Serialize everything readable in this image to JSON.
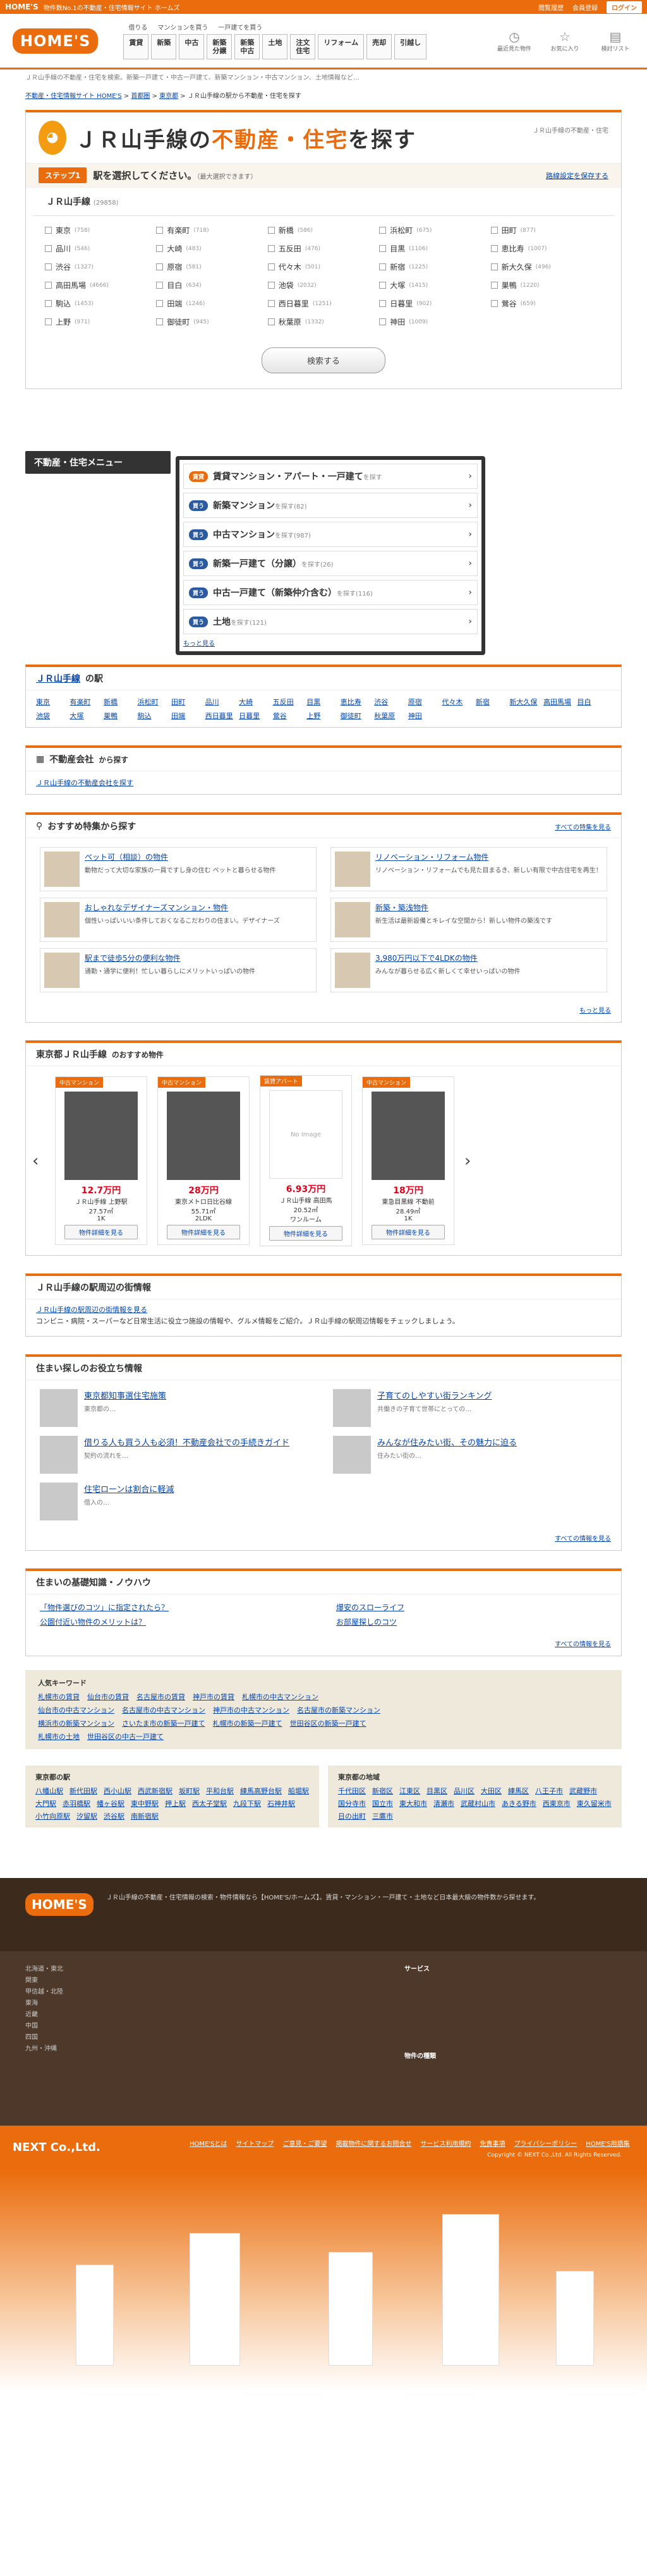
{
  "topbar": {
    "logo": "HOME'S",
    "tagline": "物件数No.1の不動産・住宅情報サイト ホームズ",
    "links": [
      "閲覧履歴",
      "会員登録",
      "ログイン"
    ]
  },
  "header": {
    "brand": "HOME'S",
    "small_links": [
      "借りる",
      "マンションを買う",
      "一戸建てを買う"
    ],
    "nav": [
      "賃貸",
      "新築",
      "中古",
      "新築\n分譲",
      "新築\n中古",
      "土地",
      "注文\n住宅",
      "リフォーム",
      "売却",
      "引越し"
    ],
    "icons": [
      {
        "icon": "history-icon",
        "label": "最近見た物件"
      },
      {
        "icon": "star-icon",
        "label": "お気に入り"
      },
      {
        "icon": "note-icon",
        "label": "検討リスト"
      }
    ]
  },
  "seo": "ＪＲ山手線の不動産・住宅を検索。新築一戸建て・中古一戸建て、新築マンション・中古マンション、土地情報など…",
  "breadcrumb": [
    "不動産・住宅情報サイト HOME'S",
    "首都圏",
    "東京都",
    "ＪＲ山手線の駅から不動産・住宅を探す"
  ],
  "hero": {
    "title_a": "ＪＲ山手線の",
    "title_b": "不動産・住宅",
    "title_c": "を探す",
    "sub": "ＪＲ山手線の不動産・住宅"
  },
  "step": {
    "label": "ステップ1",
    "text": "駅を選択してください。",
    "note": "（最大選択できます）",
    "link": "路線設定を保存する"
  },
  "line": {
    "name": "ＪＲ山手線",
    "count": "(29858)"
  },
  "stations": [
    {
      "n": "東京",
      "c": "(758)"
    },
    {
      "n": "有楽町",
      "c": "(718)"
    },
    {
      "n": "新橋",
      "c": "(586)"
    },
    {
      "n": "浜松町",
      "c": "(675)"
    },
    {
      "n": "田町",
      "c": "(877)"
    },
    {
      "n": "品川",
      "c": "(546)"
    },
    {
      "n": "大崎",
      "c": "(483)"
    },
    {
      "n": "五反田",
      "c": "(476)"
    },
    {
      "n": "目黒",
      "c": "(1106)"
    },
    {
      "n": "恵比寿",
      "c": "(1007)"
    },
    {
      "n": "渋谷",
      "c": "(1327)"
    },
    {
      "n": "原宿",
      "c": "(581)"
    },
    {
      "n": "代々木",
      "c": "(501)"
    },
    {
      "n": "新宿",
      "c": "(1225)"
    },
    {
      "n": "新大久保",
      "c": "(496)"
    },
    {
      "n": "高田馬場",
      "c": "(4666)"
    },
    {
      "n": "目白",
      "c": "(634)"
    },
    {
      "n": "池袋",
      "c": "(2032)"
    },
    {
      "n": "大塚",
      "c": "(1415)"
    },
    {
      "n": "巣鴨",
      "c": "(1220)"
    },
    {
      "n": "駒込",
      "c": "(1453)"
    },
    {
      "n": "田端",
      "c": "(1246)"
    },
    {
      "n": "西日暮里",
      "c": "(1251)"
    },
    {
      "n": "日暮里",
      "c": "(902)"
    },
    {
      "n": "鶯谷",
      "c": "(659)"
    },
    {
      "n": "上野",
      "c": "(971)"
    },
    {
      "n": "御徒町",
      "c": "(945)"
    },
    {
      "n": "秋葉原",
      "c": "(1332)"
    },
    {
      "n": "神田",
      "c": "(1009)"
    }
  ],
  "search_button": "検索する",
  "menu": {
    "title": "不動産・住宅メニュー",
    "items": [
      {
        "badge": "賃貸",
        "main": "賃貸マンション・アパート・一戸建て",
        "suffix": "を探す"
      },
      {
        "badge": "買う",
        "main": "新築マンション",
        "suffix": "を探す(82)"
      },
      {
        "badge": "買う",
        "main": "中古マンション",
        "suffix": "を探す(987)"
      },
      {
        "badge": "買う",
        "main": "新築一戸建て（分譲）",
        "suffix": "を探す(26)"
      },
      {
        "badge": "買う",
        "main": "中古一戸建て（新築仲介含む）",
        "suffix": "を探す(116)"
      },
      {
        "badge": "買う",
        "main": "土地",
        "suffix": "を探す(121)"
      }
    ],
    "more": "もっと見る"
  },
  "station_links": {
    "title": "ＪＲ山手線",
    "title_suffix": "の駅",
    "items": [
      "東京",
      "有楽町",
      "新橋",
      "浜松町",
      "田町",
      "品川",
      "大崎",
      "五反田",
      "目黒",
      "恵比寿",
      "渋谷",
      "原宿",
      "代々木",
      "新宿",
      "新大久保",
      "高田馬場",
      "目白",
      "池袋",
      "大塚",
      "巣鴨",
      "駒込",
      "田端",
      "西日暮里",
      "日暮里",
      "鶯谷",
      "上野",
      "御徒町",
      "秋葉原",
      "神田"
    ]
  },
  "companies": {
    "title": "不動産会社",
    "title_suffix": "から探す",
    "link": "ＪＲ山手線の不動産会社を探す"
  },
  "features": {
    "title": "おすすめ特集から探す",
    "all": "すべての特集を見る",
    "items": [
      {
        "t": "ペット可（相談）の物件",
        "d": "動物だって大切な家族の一員ですし身の住む ペットと暮らせる物件"
      },
      {
        "t": "リノベーション・リフォーム物件",
        "d": "リノベーション・リフォームでも見た目まるき、新しい有限で中古住宅を再生！"
      },
      {
        "t": "おしゃれなデザイナーズマンション・物件",
        "d": "個性いっぱいいい条件しておくなるこだわりの住まい。デザイナーズ"
      },
      {
        "t": "新築・築浅物件",
        "d": "新生活は最新設備とキレイな空間から！新しい物件の築浅です"
      },
      {
        "t": "駅まで徒歩5分の便利な物件",
        "d": "通勤・通学に便利！忙しい暮らしにメリットいっぱいの物件"
      },
      {
        "t": "3,980万円以下で4LDKの物件",
        "d": "みんなが暮らせる広く新しくて幸せいっぱいの物件"
      }
    ],
    "more": "もっと見る"
  },
  "props": {
    "title": "東京都ＪＲ山手線",
    "title_suffix": "のおすすめ物件",
    "items": [
      {
        "lb": "中古マンション",
        "price": "12.7万円",
        "l1": "ＪＲ山手線 上野駅",
        "l2": "27.57㎡",
        "l3": "1K",
        "btn": "物件詳細を見る"
      },
      {
        "lb": "中古マンション",
        "price": "28万円",
        "l1": "東京メトロ日比谷線",
        "l2": "55.71㎡",
        "l3": "2LDK",
        "btn": "物件詳細を見る"
      },
      {
        "lb": "賃貸アパート",
        "price": "6.93万円",
        "l1": "ＪＲ山手線 高田馬",
        "l2": "20.52㎡",
        "l3": "ワンルーム",
        "btn": "物件詳細を見る"
      },
      {
        "lb": "中古マンション",
        "price": "18万円",
        "l1": "東急目黒線 不動前",
        "l2": "28.49㎡",
        "l3": "1K",
        "btn": "物件詳細を見る"
      }
    ],
    "noimg": "No Image"
  },
  "area_info": {
    "title": "ＪＲ山手線の駅周辺の街情報",
    "link": "ＪＲ山手線の駅周辺の街情報を見る",
    "text": "コンビニ・病院・スーパーなど日常生活に役立つ施設の情報や、グルメ情報をご紹介。ＪＲ山手線の駅周辺情報をチェックしましょう。"
  },
  "tips": {
    "title": "住まい探しのお役立ち情報",
    "all": "すべての情報を見る",
    "items": [
      {
        "t": "東京都知事選住宅施策",
        "d": "東京都の…"
      },
      {
        "t": "子育てのしやすい街ランキング",
        "d": "共働きの子育て世帯にとっての…"
      },
      {
        "t": "借りる人も買う人も必須！不動産会社での手続きガイド",
        "d": "契約の流れを…"
      },
      {
        "t": "みんなが住みたい街、その魅力に迫る",
        "d": "住みたい街の…"
      },
      {
        "t": "住宅ローンは割合に軽減",
        "d": "借入の…"
      }
    ]
  },
  "knowhow": {
    "title": "住まいの基礎知識・ノウハウ",
    "items": [
      "「物件選びのコツ」に指定されたら？",
      "爆安のスローライフ",
      "公園付近い物件のメリットは？",
      "お部屋探しのコツ"
    ],
    "all": "すべての情報を見る"
  },
  "keywords": {
    "title": "人気キーワード",
    "items": [
      "札幌市の賃貸",
      "仙台市の賃貸",
      "名古屋市の賃貸",
      "神戸市の賃貸",
      "札幌市の中古マンション",
      "仙台市の中古マンション",
      "名古屋市の中古マンション",
      "神戸市の中古マンション",
      "名古屋市の新築マンション",
      "横浜市の新築マンション",
      "さいたま市の新築一戸建て",
      "札幌市の新築一戸建て",
      "世田谷区の新築一戸建て",
      "札幌市の土地",
      "世田谷区の中古一戸建て"
    ]
  },
  "area_lists": [
    {
      "title": "東京都の駅",
      "items": [
        "八幡山駅",
        "新代田駅",
        "西小山駅",
        "西武新宿駅",
        "坂町駅",
        "平和台駅",
        "練馬高野台駅",
        "船堀駅",
        "大門駅",
        "赤羽橋駅",
        "幡ヶ谷駅",
        "東中野駅",
        "押上駅",
        "西太子堂駅",
        "九段下駅",
        "石神井駅",
        "小竹向原駅",
        "汐留駅",
        "渋谷駅",
        "南新宿駅"
      ]
    },
    {
      "title": "東京都の地域",
      "items": [
        "千代田区",
        "新宿区",
        "江東区",
        "目黒区",
        "品川区",
        "大田区",
        "練馬区",
        "八王子市",
        "武蔵野市",
        "国分寺市",
        "国立市",
        "東大和市",
        "清瀬市",
        "武蔵村山市",
        "あきる野市",
        "西東京市",
        "東久留米市",
        "日の出町",
        "三鷹市"
      ]
    }
  ],
  "footer": {
    "brand": "HOME'S",
    "about": "ＪＲ山手線の不動産・住宅情報の検索・物件情報なら【HOME'S/ホームズ】。賃貸・マンション・一戸建て・土地など日本最大級の物件数から探せます。",
    "col_l": [
      "北海道・東北",
      "関東",
      "甲信越・北陸",
      "東海",
      "近畿",
      "中国",
      "四国",
      "九州・沖縄"
    ],
    "services_title": "サービス",
    "types_title": "物件の種類",
    "company": "NEXT Co.,Ltd.",
    "links": [
      "HOME'Sとは",
      "サイトマップ",
      "ご意見・ご要望",
      "掲載物件に関するお問合せ",
      "サービス利用規約",
      "免責事項",
      "プライバシーポリシー",
      "HOME'S用語集"
    ],
    "copyright": "Copyright © NEXT Co.,Ltd. All Rights Reserved."
  }
}
